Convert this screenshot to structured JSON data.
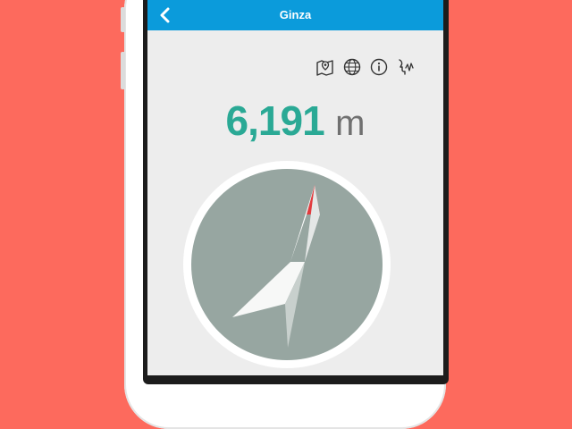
{
  "nav": {
    "title": "Ginza",
    "back_icon": "chevron-left-icon",
    "background": "#0b9bdb"
  },
  "toolbar": {
    "icons": [
      "map-pin-icon",
      "globe-icon",
      "info-icon",
      "voice-icon"
    ]
  },
  "distance": {
    "value": "6,191",
    "unit": "m",
    "value_color": "#2aa995"
  },
  "compass": {
    "needle_icon": "compass-needle-icon",
    "face_color": "#97a6a1",
    "needle_tip_color": "#e23b3e"
  },
  "background_color": "#fd6a5d"
}
